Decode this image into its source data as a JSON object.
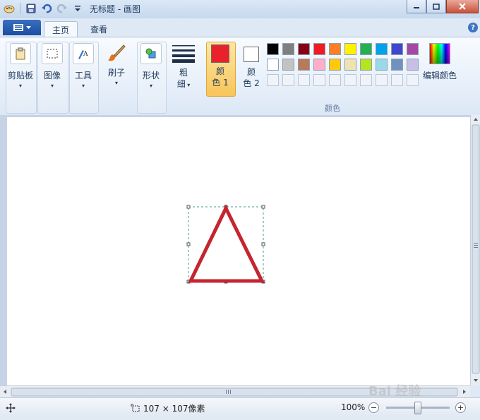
{
  "window": {
    "title": "无标题 - 画图"
  },
  "tabs": [
    {
      "label": "主页"
    },
    {
      "label": "查看"
    }
  ],
  "help_label": "?",
  "ribbon": {
    "clipboard": {
      "label": "剪贴板"
    },
    "image": {
      "label": "图像"
    },
    "tools": {
      "label": "工具"
    },
    "brushes": {
      "label": "刷子"
    },
    "shapes": {
      "label": "形状"
    },
    "size": {
      "label_line1": "粗",
      "label_line2": "细"
    },
    "color1": {
      "label_line1": "颜",
      "label_line2": "色 1",
      "value": "#e8212b"
    },
    "color2": {
      "label_line1": "颜",
      "label_line2": "色 2",
      "value": "#ffffff"
    },
    "colors_group_label": "颜色",
    "edit_colors": {
      "label": "编辑颜色"
    },
    "palette_row1": [
      "#000000",
      "#7f7f7f",
      "#880015",
      "#ed1c24",
      "#ff7f27",
      "#fff200",
      "#22b14c",
      "#00a2e8",
      "#3f48cc",
      "#a349a4"
    ],
    "palette_row2": [
      "#ffffff",
      "#c3c3c3",
      "#b97a57",
      "#ffaec9",
      "#ffc90e",
      "#efe4b0",
      "#b5e61d",
      "#99d9ea",
      "#7092be",
      "#c8bfe7"
    ]
  },
  "canvas": {
    "shape": "triangle-outline",
    "stroke_color": "#c5252f",
    "selection_color": "#4a9a92"
  },
  "status": {
    "selection_size": "107 × 107像素",
    "zoom": "100%",
    "zoom_out": "−",
    "zoom_in": "+"
  },
  "watermark": "Bai 经验"
}
